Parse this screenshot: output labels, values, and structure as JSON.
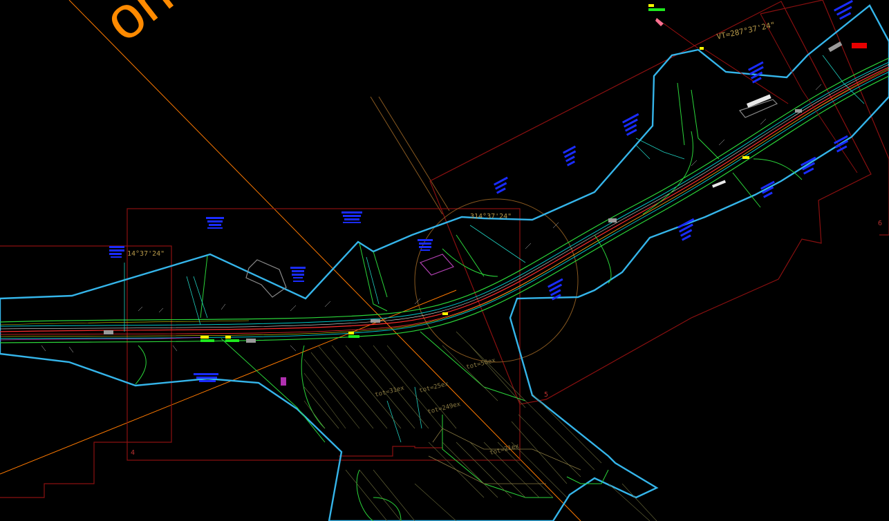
{
  "app": {
    "background_color": "#000000"
  },
  "colors": {
    "boundary": "#35b5ea",
    "sheet_frame": "#8b1010",
    "centerline": "#ff2d2d",
    "edge": "#2bd63a",
    "utility": "#00c8c8",
    "yellow": "#e0e000",
    "orange_text": "#ff8a00",
    "angle_text": "#b89a4a"
  },
  "drawing": {
    "big_text": "on",
    "angle_labels": {
      "vt": "VT=287°37'24\"",
      "center": "314°37'24\"",
      "left": "14°37'24\""
    },
    "tot_labels": {
      "a": "tot=50ex",
      "b": "tot=31ex",
      "c": "tot=25ex",
      "d": "tot=249ex",
      "e": "tot=21ex"
    },
    "sheet_numbers": {
      "s4": "4",
      "s5": "5",
      "s6": "6"
    }
  }
}
